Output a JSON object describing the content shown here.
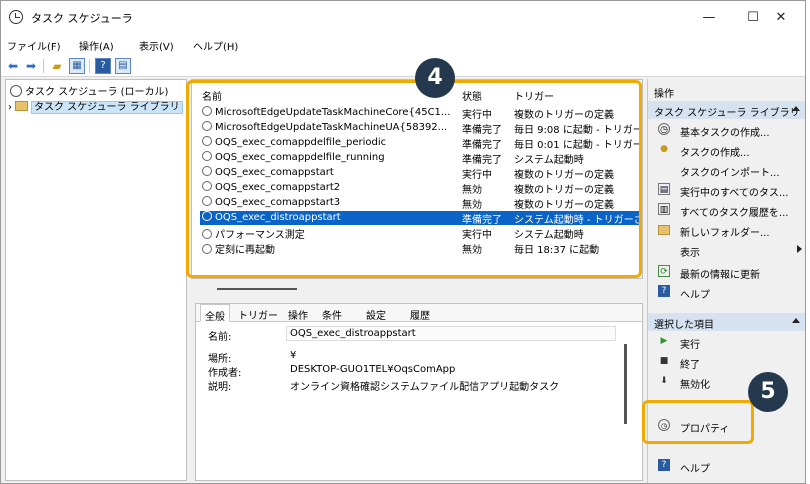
{
  "window": {
    "title": "タスク スケジューラ",
    "minimize": "—",
    "maximize": "☐",
    "close": "✕"
  },
  "menu": [
    "ファイル(F)",
    "操作(A)",
    "表示(V)",
    "ヘルプ(H)"
  ],
  "toolbar": {
    "icons": [
      "back-arrow-icon",
      "forward-arrow-icon",
      "folder-up-icon",
      "show-hide-console-tree-icon",
      "help-icon",
      "show-action-pane-icon"
    ]
  },
  "tree": {
    "root": "タスク スケジューラ (ローカル)",
    "library": "タスク スケジューラ ライブラリ"
  },
  "task_list": {
    "columns": [
      "名前",
      "状態",
      "トリガー"
    ],
    "rows": [
      {
        "name": "MicrosoftEdgeUpdateTaskMachineCore{45C1...",
        "status": "実行中",
        "trigger": "複数のトリガーの定義"
      },
      {
        "name": "MicrosoftEdgeUpdateTaskMachineUA{58392...",
        "status": "準備完了",
        "trigger": "毎日 9:08 に起動 - トリガー"
      },
      {
        "name": "OQS_exec_comappdelfile_periodic",
        "status": "準備完了",
        "trigger": "毎日 0:01 に起動 - トリガー"
      },
      {
        "name": "OQS_exec_comappdelfile_running",
        "status": "準備完了",
        "trigger": "システム起動時"
      },
      {
        "name": "OQS_exec_comappstart",
        "status": "実行中",
        "trigger": "複数のトリガーの定義"
      },
      {
        "name": "OQS_exec_comappstart2",
        "status": "無効",
        "trigger": "複数のトリガーの定義"
      },
      {
        "name": "OQS_exec_comappstart3",
        "status": "無効",
        "trigger": "複数のトリガーの定義"
      },
      {
        "name": "OQS_exec_distroappstart",
        "status": "準備完了",
        "trigger": "システム起動時 - トリガーさ"
      },
      {
        "name": "パフォーマンス測定",
        "status": "実行中",
        "trigger": "システム起動時"
      },
      {
        "name": "定刻に再起動",
        "status": "無効",
        "trigger": "毎日 18:37 に起動"
      }
    ],
    "selected_index": 7
  },
  "callouts": {
    "step4": "4",
    "step5": "5"
  },
  "details": {
    "tabs": [
      "全般",
      "トリガー",
      "操作",
      "条件",
      "設定",
      "履歴"
    ],
    "name_label": "名前:",
    "name_value": "OQS_exec_distroappstart",
    "location_label": "場所:",
    "location_value": "¥",
    "author_label": "作成者:",
    "author_value": "DESKTOP-GUO1TEL¥OqsComApp",
    "description_label": "説明:",
    "description_value": "オンライン資格確認システムファイル配信アプリ起動タスク"
  },
  "actions": {
    "header": "操作",
    "library_section": "タスク スケジューラ ライブラリ",
    "library_items": [
      {
        "label": "基本タスクの作成...",
        "icon": "basic-task-icon"
      },
      {
        "label": "タスクの作成...",
        "icon": "create-task-icon"
      },
      {
        "label": "タスクのインポート...",
        "icon": ""
      },
      {
        "label": "実行中のすべてのタス...",
        "icon": "running-tasks-icon"
      },
      {
        "label": "すべてのタスク履歴を...",
        "icon": "history-icon"
      },
      {
        "label": "新しいフォルダー...",
        "icon": "new-folder-icon"
      },
      {
        "label": "表示",
        "icon": ""
      },
      {
        "label": "最新の情報に更新",
        "icon": "refresh-icon"
      },
      {
        "label": "ヘルプ",
        "icon": "help-icon"
      }
    ],
    "selected_section": "選択した項目",
    "selected_items": [
      {
        "label": "実行",
        "icon": "run-icon"
      },
      {
        "label": "終了",
        "icon": "stop-icon"
      },
      {
        "label": "無効化",
        "icon": "disable-icon"
      },
      {
        "label": "プロパティ",
        "icon": "properties-icon"
      },
      {
        "label": "ヘルプ",
        "icon": "help-icon"
      }
    ]
  },
  "colors": {
    "selection": "#0a64c8",
    "callout": "#f2a900",
    "badge": "#24384e"
  }
}
